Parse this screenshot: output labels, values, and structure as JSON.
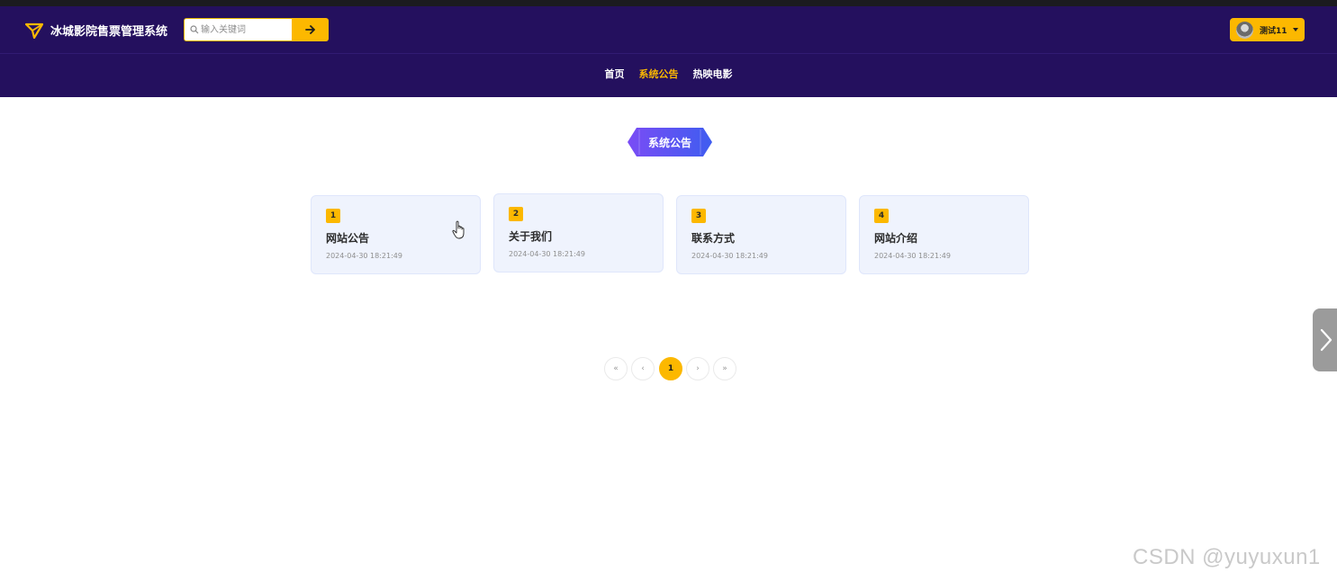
{
  "app": {
    "brand": "冰城影院售票管理系统"
  },
  "search": {
    "placeholder": "输入关键词"
  },
  "user": {
    "name": "测试11"
  },
  "nav": {
    "items": [
      {
        "label": "首页",
        "active": false
      },
      {
        "label": "系统公告",
        "active": true
      },
      {
        "label": "热映电影",
        "active": false
      }
    ]
  },
  "section": {
    "title": "系统公告"
  },
  "cards": [
    {
      "num": "1",
      "title": "网站公告",
      "date": "2024-04-30 18:21:49"
    },
    {
      "num": "2",
      "title": "关于我们",
      "date": "2024-04-30 18:21:49"
    },
    {
      "num": "3",
      "title": "联系方式",
      "date": "2024-04-30 18:21:49"
    },
    {
      "num": "4",
      "title": "网站介绍",
      "date": "2024-04-30 18:21:49"
    }
  ],
  "pagination": {
    "first": "«",
    "prev": "‹",
    "current": "1",
    "next": "›",
    "last": "»"
  },
  "watermark": "CSDN @yuyuxun1",
  "colors": {
    "header_bg": "#24105e",
    "accent": "#fcb800",
    "card_bg": "#eff3fd"
  }
}
